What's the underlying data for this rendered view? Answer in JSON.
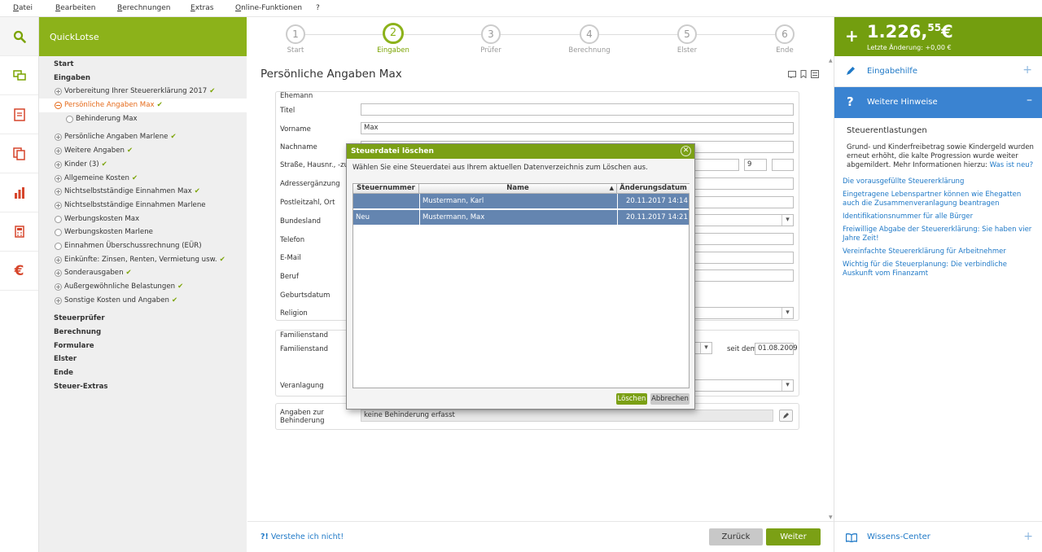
{
  "menu": [
    "Datei",
    "Bearbeiten",
    "Berechnungen",
    "Extras",
    "Online-Funktionen",
    "?"
  ],
  "sidebar": {
    "title": "QuickLotse",
    "items": [
      {
        "label": "Start",
        "type": "section"
      },
      {
        "label": "Eingaben",
        "type": "section"
      },
      {
        "label": "Vorbereitung Ihrer Steuererklärung 2017",
        "type": "plus",
        "check": true
      },
      {
        "label": "Persönliche Angaben Max",
        "type": "minus",
        "check": true,
        "active": true
      },
      {
        "label": "Behinderung Max",
        "type": "circle",
        "indent": 2
      },
      {
        "label": "Persönliche Angaben Marlene",
        "type": "plus",
        "check": true,
        "gap": true
      },
      {
        "label": "Weitere Angaben",
        "type": "plus",
        "check": true
      },
      {
        "label": "Kinder (3)",
        "type": "plus",
        "check": true
      },
      {
        "label": "Allgemeine Kosten",
        "type": "plus",
        "check": true
      },
      {
        "label": "Nichtselbstständige Einnahmen Max",
        "type": "plus",
        "check": true
      },
      {
        "label": "Nichtselbstständige Einnahmen Marlene",
        "type": "plus"
      },
      {
        "label": "Werbungskosten Max",
        "type": "circle"
      },
      {
        "label": "Werbungskosten Marlene",
        "type": "circle"
      },
      {
        "label": "Einnahmen Überschussrechnung (EÜR)",
        "type": "circle"
      },
      {
        "label": "Einkünfte: Zinsen, Renten, Vermietung usw.",
        "type": "plus",
        "check": true
      },
      {
        "label": "Sonderausgaben",
        "type": "plus",
        "check": true
      },
      {
        "label": "Außergewöhnliche Belastungen",
        "type": "plus",
        "check": true
      },
      {
        "label": "Sonstige Kosten und Angaben",
        "type": "plus",
        "check": true
      },
      {
        "label": "Steuerprüfer",
        "type": "section",
        "gap": true
      },
      {
        "label": "Berechnung",
        "type": "section"
      },
      {
        "label": "Formulare",
        "type": "section"
      },
      {
        "label": "Elster",
        "type": "section"
      },
      {
        "label": "Ende",
        "type": "section"
      },
      {
        "label": "Steuer-Extras",
        "type": "section"
      }
    ]
  },
  "steps": [
    {
      "num": "1",
      "label": "Start"
    },
    {
      "num": "2",
      "label": "Eingaben",
      "current": true
    },
    {
      "num": "3",
      "label": "Prüfer"
    },
    {
      "num": "4",
      "label": "Berechnung"
    },
    {
      "num": "5",
      "label": "Elster"
    },
    {
      "num": "6",
      "label": "Ende"
    }
  ],
  "page_title": "Persönliche Angaben Max",
  "form": {
    "section_ehemann": "Ehemann",
    "titel_label": "Titel",
    "vorname_label": "Vorname",
    "vorname_value": "Max",
    "nachname_label": "Nachname",
    "strasse_label": "Straße, Hausnr., -zusatz",
    "hausnr_value": "9",
    "adresse_label": "Adressergänzung",
    "plz_label": "Postleitzahl, Ort",
    "bundesland_label": "Bundesland",
    "telefon_label": "Telefon",
    "email_label": "E-Mail",
    "beruf_label": "Beruf",
    "geburtsdatum_label": "Geburtsdatum",
    "religion_label": "Religion",
    "section_familienstand": "Familienstand",
    "familienstand_label": "Familienstand",
    "seit_dem_label": "seit dem",
    "seit_dem_value": "01.08.2009",
    "veranlagung_label": "Veranlagung",
    "behinderung_label": "Angaben zur Behinderung",
    "behinderung_value": "keine Behinderung erfasst"
  },
  "bottom": {
    "help_link": "Verstehe ich nicht!",
    "back_button": "Zurück",
    "next_button": "Weiter"
  },
  "right_panel": {
    "amount_main": "1.226,",
    "amount_cents": "55",
    "amount_currency": "€",
    "last_change": "Letzte Änderung: +0,00 €",
    "eingabehilfe": "Eingabehilfe",
    "weitere_hinweise": "Weitere Hinweise",
    "heading": "Steuerentlastungen",
    "text": "Grund- und Kinderfreibetrag sowie Kindergeld wurden erneut erhöht, die kalte Progression wurde weiter abgemildert. Mehr Informationen hierzu:",
    "text_link": "Was ist neu?",
    "links": [
      "Die vorausgefüllte Steuererklärung",
      "Eingetragene Lebenspartner können wie Ehegatten auch die Zusammenveranlagung beantragen",
      "Identifikationsnummer für alle Bürger",
      "Freiwillige Abgabe der Steuererklärung: Sie haben vier Jahre Zeit!",
      "Vereinfachte Steuererklärung für Arbeitnehmer",
      "Wichtig für die Steuerplanung: Die verbindliche Auskunft vom Finanzamt"
    ],
    "wissens_center": "Wissens-Center"
  },
  "dialog": {
    "title": "Steuerdatei löschen",
    "message": "Wählen Sie eine Steuerdatei aus Ihrem aktuellen Datenverzeichnis zum Löschen aus.",
    "columns": [
      "Steuernummer",
      "Name",
      "Änderungsdatum"
    ],
    "rows": [
      {
        "steuernummer": "",
        "name": "Mustermann, Karl",
        "datum": "20.11.2017 14:14"
      },
      {
        "steuernummer": "Neu",
        "name": "Mustermann, Max",
        "datum": "20.11.2017 14:21"
      }
    ],
    "delete_button": "Löschen",
    "cancel_button": "Abbrechen"
  },
  "colors": {
    "brand_green": "#8cb21a",
    "dark_green": "#739e0f",
    "accent_orange": "#e56a1a",
    "link_blue": "#1f79c7",
    "selection_blue": "#6485b0"
  },
  "icons": [
    "search-icon",
    "chat-icon",
    "form-icon",
    "copy-icon",
    "bar-chart-icon",
    "calculator-icon",
    "euro-icon",
    "pencil-icon",
    "question-icon",
    "book-icon"
  ]
}
